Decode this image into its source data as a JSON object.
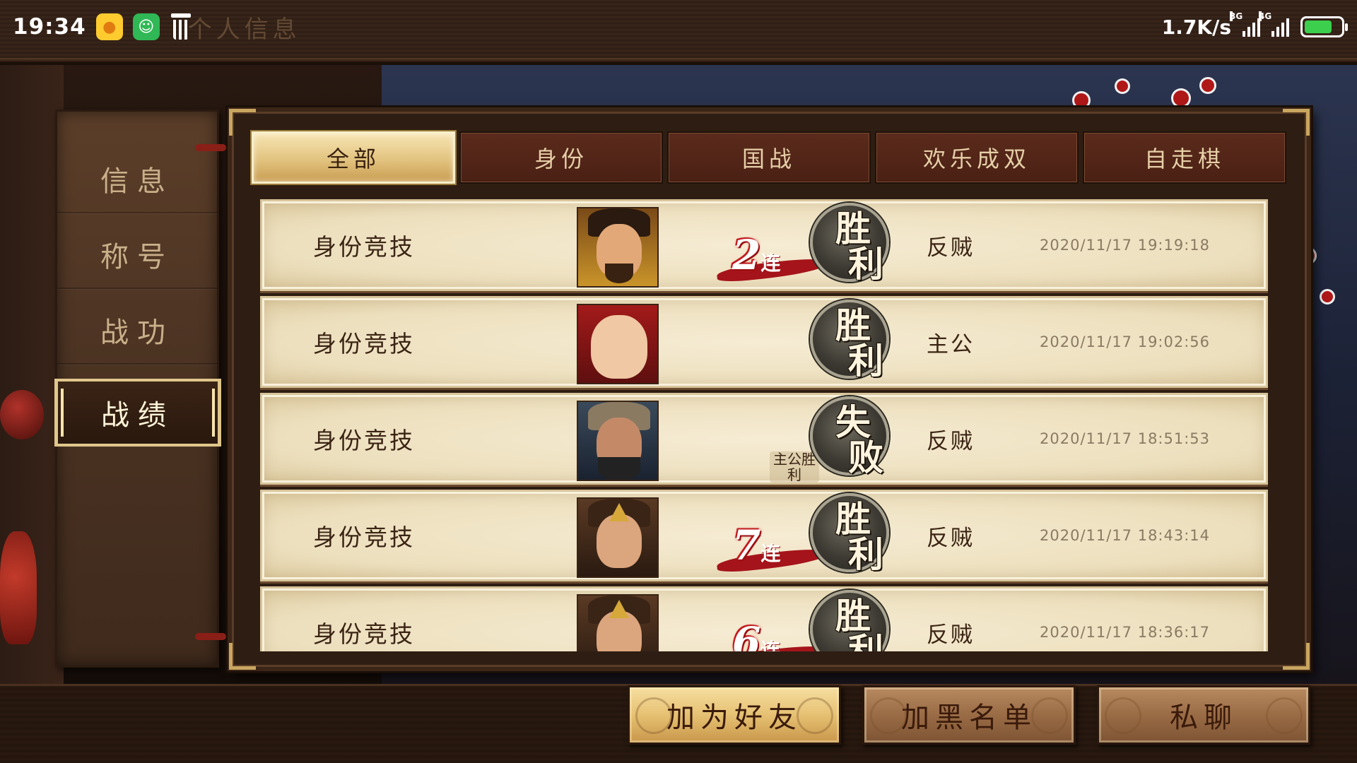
{
  "status_bar": {
    "time": "19:34",
    "network_speed": "1.7K/s",
    "signal1_tag": "3G",
    "signal2_tag": "4G",
    "battery_level": 0.75
  },
  "page_title": "个人信息",
  "side_tabs": [
    {
      "label": "信息",
      "active": false
    },
    {
      "label": "称号",
      "active": false
    },
    {
      "label": "战功",
      "active": false
    },
    {
      "label": "战绩",
      "active": true
    }
  ],
  "filter_tabs": [
    {
      "label": "全部",
      "active": true
    },
    {
      "label": "身份",
      "active": false
    },
    {
      "label": "国战",
      "active": false
    },
    {
      "label": "欢乐成双",
      "active": false
    },
    {
      "label": "自走棋",
      "active": false
    }
  ],
  "records": [
    {
      "mode": "身份竞技",
      "hero": "general-portrait",
      "result": [
        "胜",
        "利"
      ],
      "streak_num": "2",
      "streak_char": "连",
      "note": "",
      "role": "反贼",
      "time": "2020/11/17  19:19:18"
    },
    {
      "mode": "身份竞技",
      "hero": "chubby-portrait",
      "result": [
        "胜",
        "利"
      ],
      "streak_num": "",
      "streak_char": "",
      "note": "",
      "role": "主公",
      "time": "2020/11/17  19:02:56"
    },
    {
      "mode": "身份竞技",
      "hero": "bearded-portrait",
      "result": [
        "失",
        "败"
      ],
      "streak_num": "",
      "streak_char": "",
      "note": "主公胜利",
      "role": "反贼",
      "time": "2020/11/17  18:51:53"
    },
    {
      "mode": "身份竞技",
      "hero": "crowned-portrait",
      "result": [
        "胜",
        "利"
      ],
      "streak_num": "7",
      "streak_char": "连",
      "note": "",
      "role": "反贼",
      "time": "2020/11/17  18:43:14"
    },
    {
      "mode": "身份竞技",
      "hero": "crowned-portrait",
      "result": [
        "胜",
        "利"
      ],
      "streak_num": "6",
      "streak_char": "连",
      "note": "",
      "role": "反贼",
      "time": "2020/11/17  18:36:17"
    }
  ],
  "actions": {
    "add_friend": "加为好友",
    "blacklist": "加黑名单",
    "private_chat": "私聊"
  },
  "colors": {
    "gold_button": "#e6c173",
    "brown_button": "#9a6c46",
    "streak_red": "#a5141a",
    "active_tab_border": "#e0c78b"
  }
}
